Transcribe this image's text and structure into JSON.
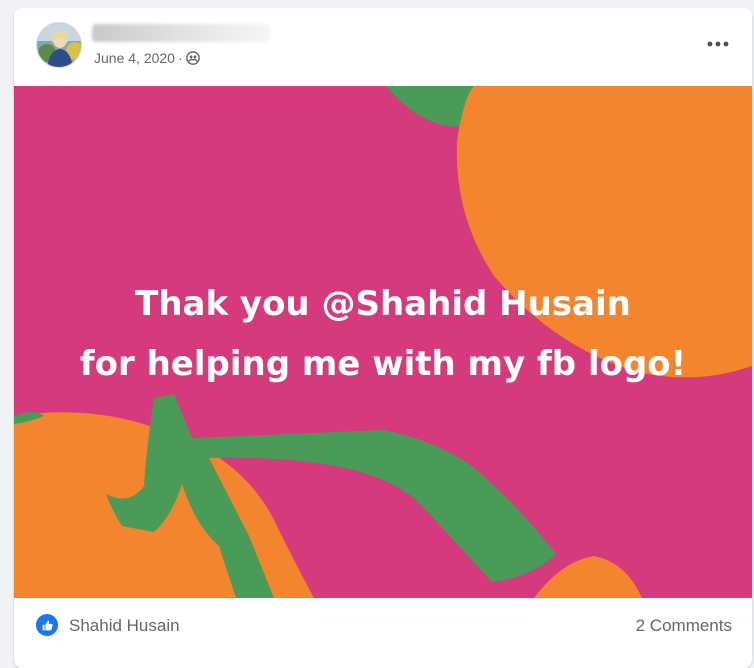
{
  "post": {
    "date": "June 4, 2020",
    "separator": "·",
    "audience_icon": "friends-icon",
    "more_icon": "more-options-icon",
    "image_text": {
      "line1": "Thak you @Shahid Husain",
      "line2": "for helping me with my fb logo!"
    }
  },
  "reactions": {
    "icon": "like-icon",
    "names": "Shahid Husain"
  },
  "comments": {
    "label": "2 Comments"
  },
  "colors": {
    "background_pink": "#d53a7c",
    "orange": "#f2852d",
    "leaf_green": "#4a9b57",
    "like_blue": "#1877f2",
    "meta_gray": "#65676b"
  }
}
